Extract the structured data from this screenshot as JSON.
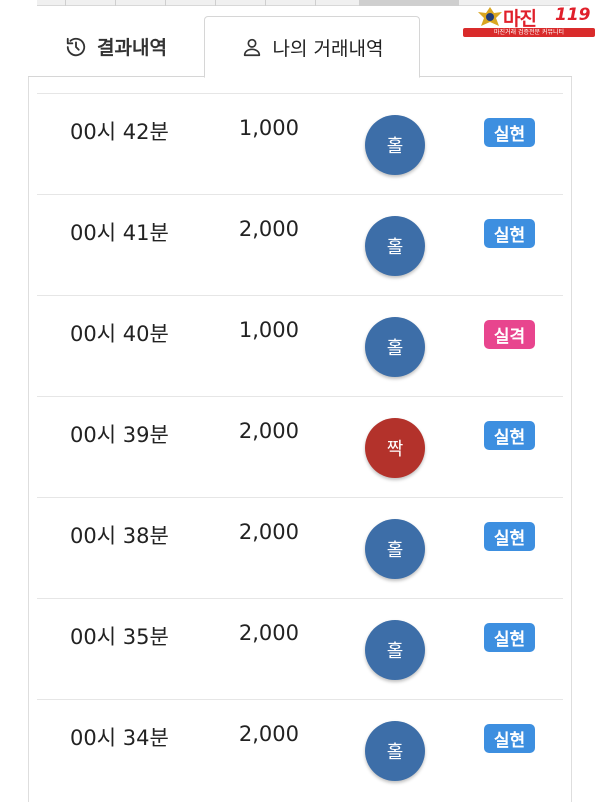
{
  "tabs": {
    "results_label": "결과내역",
    "mine_label": "나의 거래내역"
  },
  "logo": {
    "name": "마진",
    "number": "119",
    "tagline": "마진거래 검증전문 커뮤니티"
  },
  "colors": {
    "odd": "#3d6ea8",
    "even": "#b3322b",
    "win": "#3d8fe0",
    "lose": "#e8458e"
  },
  "rows": [
    {
      "time": "00시 42분",
      "amount": "1,000",
      "pick": "홀",
      "pick_type": "odd",
      "result": "실현",
      "result_type": "win"
    },
    {
      "time": "00시 41분",
      "amount": "2,000",
      "pick": "홀",
      "pick_type": "odd",
      "result": "실현",
      "result_type": "win"
    },
    {
      "time": "00시 40분",
      "amount": "1,000",
      "pick": "홀",
      "pick_type": "odd",
      "result": "실격",
      "result_type": "lose"
    },
    {
      "time": "00시 39분",
      "amount": "2,000",
      "pick": "짝",
      "pick_type": "even",
      "result": "실현",
      "result_type": "win"
    },
    {
      "time": "00시 38분",
      "amount": "2,000",
      "pick": "홀",
      "pick_type": "odd",
      "result": "실현",
      "result_type": "win"
    },
    {
      "time": "00시 35분",
      "amount": "2,000",
      "pick": "홀",
      "pick_type": "odd",
      "result": "실현",
      "result_type": "win"
    },
    {
      "time": "00시 34분",
      "amount": "2,000",
      "pick": "홀",
      "pick_type": "odd",
      "result": "실현",
      "result_type": "win"
    }
  ]
}
